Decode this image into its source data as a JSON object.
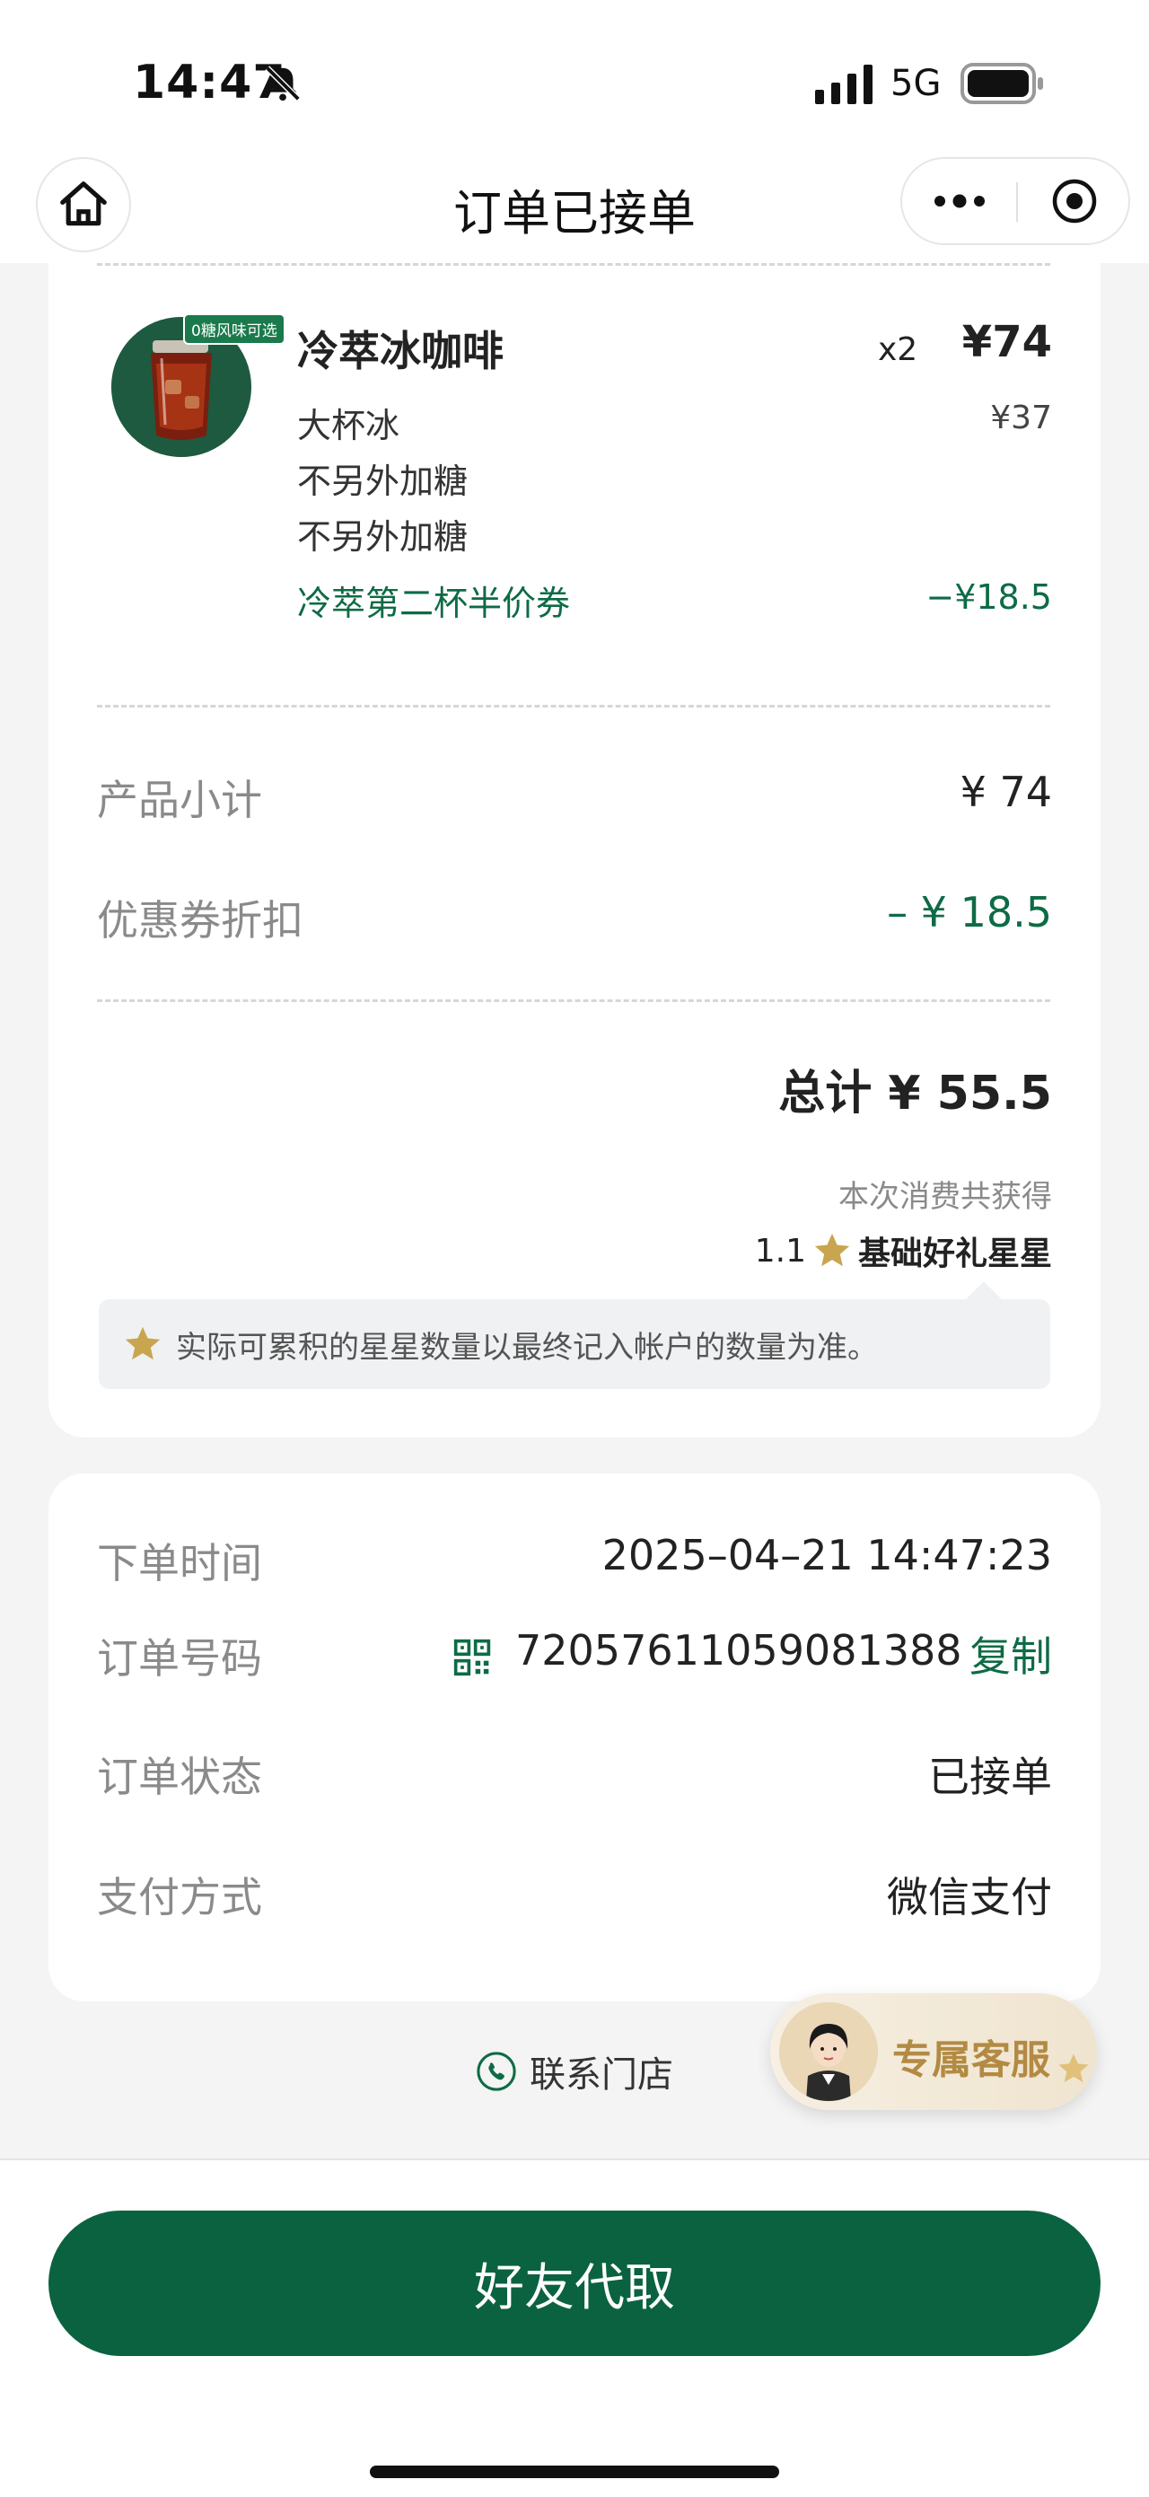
{
  "status_bar": {
    "time": "14:47",
    "network": "5G"
  },
  "nav": {
    "title": "订单已接单"
  },
  "item": {
    "image_tag": "0糖风味可选",
    "name": "冷萃冰咖啡",
    "qty": "x2",
    "price": "¥74",
    "unit_price": "¥37",
    "options": [
      "大杯冰",
      "不另外加糖",
      "不另外加糖"
    ],
    "coupon_name": "冷萃第二杯半价券",
    "coupon_value": "−¥18.5"
  },
  "summary": {
    "subtotal_label": "产品小计",
    "subtotal_value": "¥ 74",
    "discount_label": "优惠券折扣",
    "discount_value": "– ¥ 18.5",
    "total": "总计 ¥ 55.5",
    "earn_note": "本次消费共获得",
    "earn_count": "1.1",
    "earn_label": "基础好礼星星",
    "notice": "实际可累积的星星数量以最终记入帐户的数量为准。"
  },
  "order_info": {
    "time_label": "下单时间",
    "time_value": "2025–04–21 14:47:23",
    "number_label": "订单号码",
    "number_value": "72057611059081388",
    "copy_label": "复制",
    "status_label": "订单状态",
    "status_value": "已接单",
    "payment_label": "支付方式",
    "payment_value": "微信支付"
  },
  "contact": {
    "label": "联系门店"
  },
  "service": {
    "label": "专属客服"
  },
  "bottom": {
    "button_label": "好友代取"
  },
  "colors": {
    "brand_green": "#0b6240",
    "text_green": "#0e6b45",
    "star_gold": "#c9a550"
  }
}
